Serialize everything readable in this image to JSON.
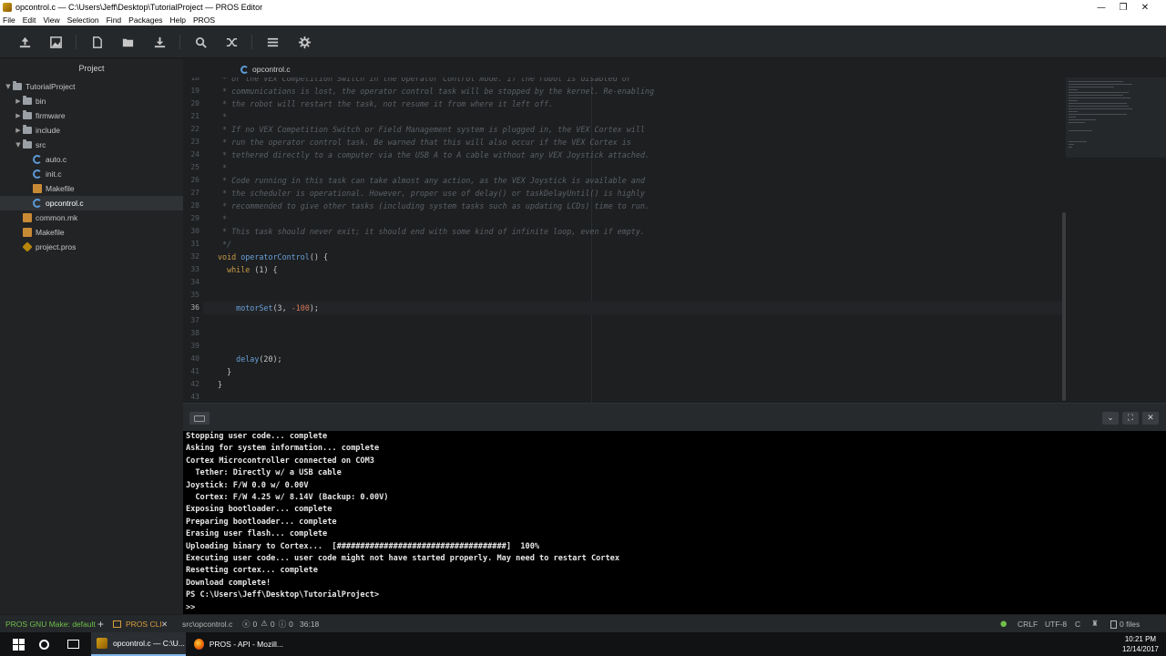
{
  "window": {
    "title": "opcontrol.c — C:\\Users\\Jeff\\Desktop\\TutorialProject — PROS Editor"
  },
  "menu": [
    "File",
    "Edit",
    "View",
    "Selection",
    "Find",
    "Packages",
    "Help",
    "PROS"
  ],
  "toolbar": {
    "icons": [
      "upload-icon",
      "image-save-icon",
      "new-file-icon",
      "open-folder-icon",
      "download-icon",
      "search-icon",
      "shuffle-icon",
      "menu-icon",
      "gear-icon"
    ]
  },
  "tree": {
    "header": "Project",
    "items": [
      {
        "label": "TutorialProject",
        "type": "folder",
        "arrow": "▼"
      },
      {
        "label": "bin",
        "type": "folder",
        "arrow": "▶"
      },
      {
        "label": "firmware",
        "type": "folder",
        "arrow": "▶"
      },
      {
        "label": "include",
        "type": "folder",
        "arrow": "▶"
      },
      {
        "label": "src",
        "type": "folder",
        "arrow": "▼"
      },
      {
        "label": "auto.c",
        "type": "c"
      },
      {
        "label": "init.c",
        "type": "c"
      },
      {
        "label": "Makefile",
        "type": "make"
      },
      {
        "label": "opcontrol.c",
        "type": "c",
        "selected": true
      },
      {
        "label": "common.mk",
        "type": "make"
      },
      {
        "label": "Makefile",
        "type": "make"
      },
      {
        "label": "project.pros",
        "type": "pros"
      }
    ]
  },
  "editor": {
    "tab_label": "opcontrol.c",
    "current_line": "36",
    "lines": [
      {
        "n": "18",
        "segs": [
          [
            "cm",
            " * or the VEX Competition Switch in the Operator Control mode. If the robot is disabled or"
          ]
        ]
      },
      {
        "n": "19",
        "segs": [
          [
            "cm",
            " * communications is lost, the operator control task will be stopped by the kernel. Re-enabling"
          ]
        ]
      },
      {
        "n": "20",
        "segs": [
          [
            "cm",
            " * the robot will restart the task, not resume it from where it left off."
          ]
        ]
      },
      {
        "n": "21",
        "segs": [
          [
            "cm",
            " *"
          ]
        ]
      },
      {
        "n": "22",
        "segs": [
          [
            "cm",
            " * If no VEX Competition Switch or Field Management system is plugged in, the VEX Cortex will"
          ]
        ]
      },
      {
        "n": "23",
        "segs": [
          [
            "cm",
            " * run the operator control task. Be warned that this will also occur if the VEX Cortex is"
          ]
        ]
      },
      {
        "n": "24",
        "segs": [
          [
            "cm",
            " * tethered directly to a computer via the USB A to A cable without any VEX Joystick attached."
          ]
        ]
      },
      {
        "n": "25",
        "segs": [
          [
            "cm",
            " *"
          ]
        ]
      },
      {
        "n": "26",
        "segs": [
          [
            "cm",
            " * Code running in this task can take almost any action, as the VEX Joystick is available and"
          ]
        ]
      },
      {
        "n": "27",
        "segs": [
          [
            "cm",
            " * the scheduler is operational. However, proper use of delay() or taskDelayUntil() is highly"
          ]
        ]
      },
      {
        "n": "28",
        "segs": [
          [
            "cm",
            " * recommended to give other tasks (including system tasks such as updating LCDs) time to run."
          ]
        ]
      },
      {
        "n": "29",
        "segs": [
          [
            "cm",
            " *"
          ]
        ]
      },
      {
        "n": "30",
        "segs": [
          [
            "cm",
            " * This task should never exit; it should end with some kind of infinite loop, even if empty."
          ]
        ]
      },
      {
        "n": "31",
        "segs": [
          [
            "cm",
            " */"
          ]
        ]
      },
      {
        "n": "32",
        "segs": [
          [
            "kw",
            "void "
          ],
          [
            "fn",
            "operatorControl"
          ],
          [
            "tx",
            "() {"
          ]
        ]
      },
      {
        "n": "33",
        "segs": [
          [
            "tx",
            "  "
          ],
          [
            "kw",
            "while"
          ],
          [
            "tx",
            " (1) {"
          ]
        ]
      },
      {
        "n": "34",
        "segs": []
      },
      {
        "n": "35",
        "segs": []
      },
      {
        "n": "36",
        "segs": [
          [
            "tx",
            "    "
          ],
          [
            "fn",
            "motorSet"
          ],
          [
            "tx",
            "(3, "
          ],
          [
            "num",
            "-100"
          ],
          [
            "tx",
            ");"
          ]
        ]
      },
      {
        "n": "37",
        "segs": []
      },
      {
        "n": "38",
        "segs": []
      },
      {
        "n": "39",
        "segs": []
      },
      {
        "n": "40",
        "segs": [
          [
            "tx",
            "    "
          ],
          [
            "fn",
            "delay"
          ],
          [
            "tx",
            "(20);"
          ]
        ]
      },
      {
        "n": "41",
        "segs": [
          [
            "tx",
            "  }"
          ]
        ]
      },
      {
        "n": "42",
        "segs": [
          [
            "tx",
            "}"
          ]
        ]
      },
      {
        "n": "43",
        "segs": []
      }
    ]
  },
  "terminal": {
    "lines": [
      "Stopping user code... complete",
      "Asking for system information... complete",
      "Cortex Microcontroller connected on COM3",
      "  Tether: Directly w/ a USB cable",
      "Joystick: F/W 0.0 w/ 0.00V",
      "  Cortex: F/W 4.25 w/ 8.14V (Backup: 0.00V)",
      "Exposing bootloader... complete",
      "Preparing bootloader... complete",
      "Erasing user flash... complete",
      "Uploading binary to Cortex...  [####################################]  100%",
      "Executing user code... user code might not have started properly. May need to restart Cortex",
      "Resetting cortex... complete",
      "Download complete!",
      "PS C:\\Users\\Jeff\\Desktop\\TutorialProject>",
      ">>"
    ]
  },
  "status": {
    "make": "PROS GNU Make: default",
    "add": "+",
    "cli": "PROS CLI",
    "close": "✕",
    "path": "src\\opcontrol.c",
    "errors": "0",
    "warnings": "0",
    "infos": "0",
    "cursor": "36:18",
    "line_ending": "CRLF",
    "encoding": "UTF-8",
    "grammar": "C",
    "files": "0 files"
  },
  "taskbar": {
    "task1": "opcontrol.c — C:\\U...",
    "task2": "PROS - API - Mozill...",
    "time": "10:21 PM",
    "date": "12/14/2017"
  },
  "colors": {
    "accent": "#6fbf4a",
    "keyword": "#cc9a48",
    "function": "#6aa0d8",
    "number": "#d87a5c"
  }
}
